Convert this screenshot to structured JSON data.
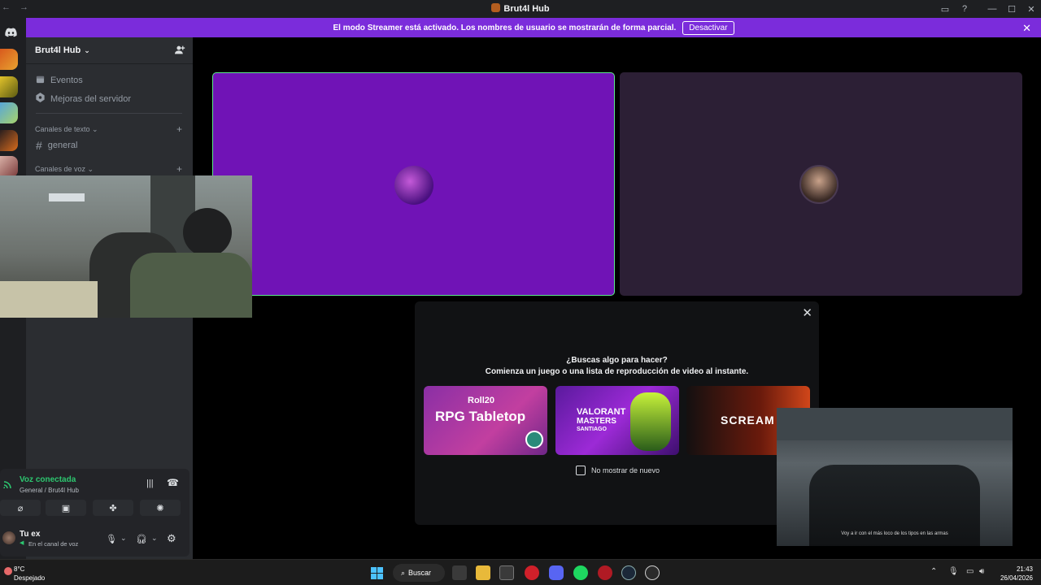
{
  "window": {
    "title": "Brut4l Hub",
    "nav": "← →"
  },
  "streamer_banner": {
    "text": "El modo Streamer está activado. Los nombres de usuario se mostrarán de forma parcial.",
    "button": "Desactivar"
  },
  "server": {
    "name": "Brut4l Hub",
    "items": [
      {
        "label": "Eventos",
        "icon": "calendar-icon"
      },
      {
        "label": "Mejoras del servidor",
        "icon": "boost-icon"
      }
    ],
    "categories": {
      "text": "Canales de texto",
      "voice": "Canales de voz"
    },
    "channels": [
      {
        "name": "general"
      }
    ]
  },
  "voice": {
    "status": "Voz conectada",
    "location": "General / Brut4l Hub"
  },
  "user": {
    "name": "Tu ex",
    "status": "En el canal de voz"
  },
  "activity_modal": {
    "heading": "¿Buscas algo para hacer?",
    "subheading": "Comienza un juego o una lista de reproducción de video al instante.",
    "cards": [
      {
        "brand": "Roll20",
        "title": "RPG Tabletop"
      },
      {
        "brand": "VALORANT",
        "title": "MASTERS",
        "sub": "SANTIAGO"
      },
      {
        "brand": "SCREAM",
        "title": "SCREAM 7"
      }
    ],
    "checkbox_label": "No mostrar de nuevo"
  },
  "video_overlay": {
    "subtitle": "Voy a ir con el más loco de los tipos en las armas"
  },
  "taskbar": {
    "weather_temp": "8°C",
    "weather_desc": "Despejado",
    "search": "Buscar",
    "time": "21:43",
    "date": "26/04/2026"
  },
  "colors": {
    "streamer_bar": "#7b2cdb",
    "voice_connected": "#2dc770",
    "speaking_border": "#5ce88a"
  }
}
